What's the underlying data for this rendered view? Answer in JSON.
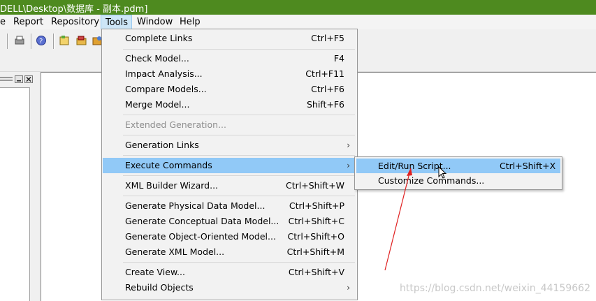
{
  "window": {
    "title": "DELL\\Desktop\\数据库 - 副本.pdm]"
  },
  "menubar": {
    "items": [
      {
        "label": "e"
      },
      {
        "label": "Report"
      },
      {
        "label": "Repository"
      },
      {
        "label": "Tools"
      },
      {
        "label": "Window"
      },
      {
        "label": "Help"
      }
    ]
  },
  "tools_menu": {
    "items": [
      {
        "label": "Complete Links",
        "shortcut": "Ctrl+F5"
      },
      {
        "label": "Check Model...",
        "shortcut": "F4"
      },
      {
        "label": "Impact Analysis...",
        "shortcut": "Ctrl+F11"
      },
      {
        "label": "Compare Models...",
        "shortcut": "Ctrl+F6"
      },
      {
        "label": "Merge Model...",
        "shortcut": "Shift+F6"
      },
      {
        "label": "Extended Generation...",
        "shortcut": ""
      },
      {
        "label": "Generation Links",
        "shortcut": ""
      },
      {
        "label": "Execute Commands",
        "shortcut": ""
      },
      {
        "label": "XML Builder Wizard...",
        "shortcut": "Ctrl+Shift+W"
      },
      {
        "label": "Generate Physical Data Model...",
        "shortcut": "Ctrl+Shift+P"
      },
      {
        "label": "Generate Conceptual Data Model...",
        "shortcut": "Ctrl+Shift+C"
      },
      {
        "label": "Generate Object-Oriented Model...",
        "shortcut": "Ctrl+Shift+O"
      },
      {
        "label": "Generate XML Model...",
        "shortcut": "Ctrl+Shift+M"
      },
      {
        "label": "Create View...",
        "shortcut": "Ctrl+Shift+V"
      },
      {
        "label": "Rebuild Objects",
        "shortcut": ""
      }
    ]
  },
  "execute_submenu": {
    "items": [
      {
        "label": "Edit/Run Script...",
        "shortcut": "Ctrl+Shift+X"
      },
      {
        "label": "Customize Commands...",
        "shortcut": ""
      }
    ]
  },
  "watermark": "https://blog.csdn.net/weixin_44159662",
  "colors": {
    "titlebar": "#4e8a1f",
    "highlight": "#91c9f7",
    "annotation_arrow": "#e02020"
  }
}
